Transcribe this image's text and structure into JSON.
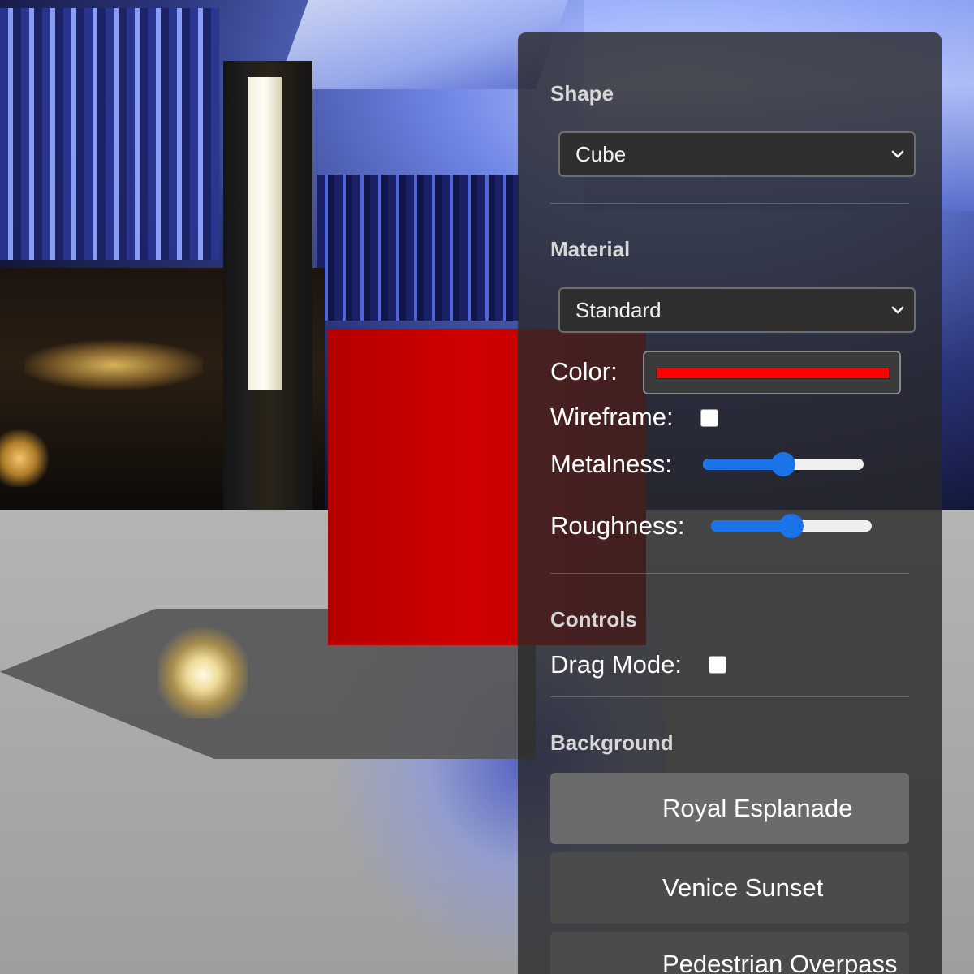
{
  "panel": {
    "shape": {
      "title": "Shape",
      "selected": "Cube"
    },
    "material": {
      "title": "Material",
      "selected": "Standard",
      "color_label": "Color:",
      "color_value": "#ff0000",
      "wireframe_label": "Wireframe:",
      "wireframe_checked": false,
      "metalness_label": "Metalness:",
      "metalness_value": 0.5,
      "roughness_label": "Roughness:",
      "roughness_value": 0.5
    },
    "controls": {
      "title": "Controls",
      "drag_mode_label": "Drag Mode:",
      "drag_mode_checked": false
    },
    "background": {
      "title": "Background",
      "options": [
        {
          "label": "Royal Esplanade",
          "active": true
        },
        {
          "label": "Venice Sunset",
          "active": false
        },
        {
          "label": "Pedestrian Overpass",
          "active": false
        }
      ]
    }
  },
  "colors": {
    "accent": "#1a73e8",
    "cube": "#d00000",
    "panel_bg": "#282828"
  }
}
